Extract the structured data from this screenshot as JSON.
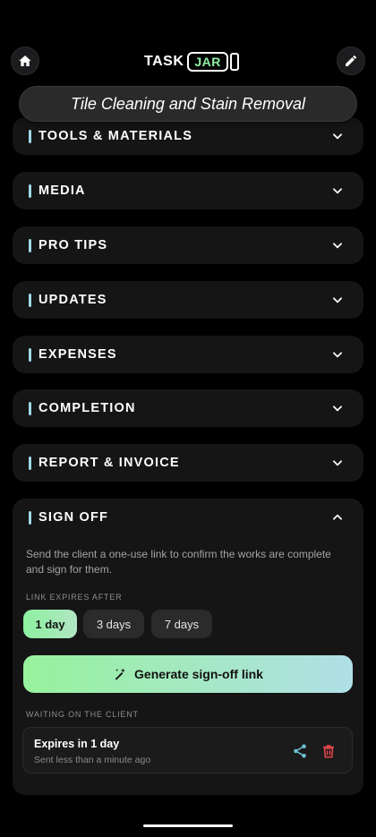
{
  "header": {
    "logo_task": "TASK",
    "logo_jar": "JAR",
    "home_icon": "home-icon",
    "edit_icon": "pencil-icon"
  },
  "task_title": "Tile Cleaning and Stain Removal",
  "sections": [
    {
      "label": "TOOLS & MATERIALS"
    },
    {
      "label": "MEDIA"
    },
    {
      "label": "PRO TIPS"
    },
    {
      "label": "UPDATES"
    },
    {
      "label": "EXPENSES"
    },
    {
      "label": "COMPLETION"
    },
    {
      "label": "REPORT & INVOICE"
    }
  ],
  "signoff": {
    "label": "SIGN OFF",
    "description": "Send the client a one-use link to confirm the works are complete and sign for them.",
    "expires_label": "LINK EXPIRES AFTER",
    "options": [
      "1 day",
      "3 days",
      "7 days"
    ],
    "selected": "1 day",
    "generate_label": "Generate sign-off link",
    "waiting_label": "WAITING ON THE CLIENT",
    "pending": {
      "title": "Expires in 1 day",
      "subtitle": "Sent less than a minute ago"
    }
  },
  "colors": {
    "accent_green": "#8cf0a0",
    "accent_blue": "#b0dfe7",
    "delete_red": "#e5484d",
    "share_teal": "#6fc3d4"
  }
}
